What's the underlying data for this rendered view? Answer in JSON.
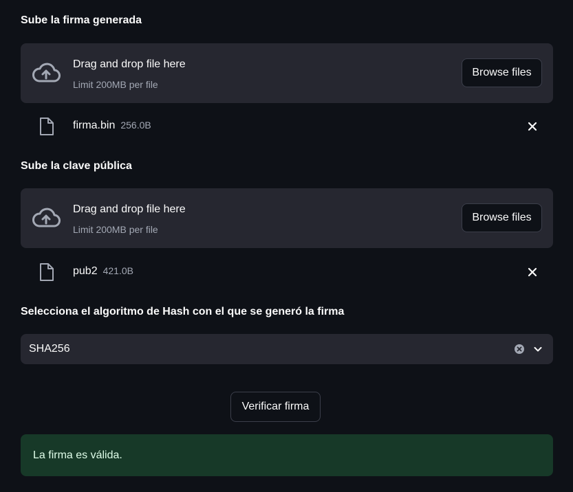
{
  "uploader_signature": {
    "label": "Sube la firma generada",
    "drop_title": "Drag and drop file here",
    "drop_limit": "Limit 200MB per file",
    "browse_label": "Browse files",
    "file": {
      "name": "firma.bin",
      "size": "256.0B"
    }
  },
  "uploader_public_key": {
    "label": "Sube la clave pública",
    "drop_title": "Drag and drop file here",
    "drop_limit": "Limit 200MB per file",
    "browse_label": "Browse files",
    "file": {
      "name": "pub2",
      "size": "421.0B"
    }
  },
  "hash_select": {
    "label": "Selecciona el algoritmo de Hash con el que se generó la firma",
    "value": "SHA256"
  },
  "verify_button": {
    "label": "Verificar firma"
  },
  "result": {
    "message": "La firma es válida."
  },
  "colors": {
    "background": "#0e1117",
    "panel": "#262730",
    "success_bg": "#173928",
    "success_text": "#dffde9",
    "muted_text": "#a3a8b4"
  },
  "icons": {
    "upload": "cloud-upload-icon",
    "file": "file-icon",
    "remove": "close-icon",
    "clear": "clear-circle-icon",
    "dropdown": "chevron-down-icon"
  }
}
